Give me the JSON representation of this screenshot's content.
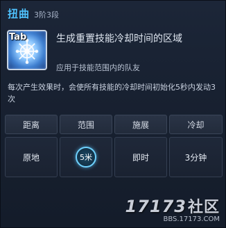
{
  "skill": {
    "name": "扭曲",
    "level": "3阶3段",
    "hotkey": "Tab",
    "icon": "swirl-snowflake-icon",
    "title": "生成重置技能冷却时间的区域",
    "subtitle": "应用于技能范围内的队友",
    "effect": "每次产生效果时，会使所有技能的冷却时间初始化5秒内发动3次"
  },
  "stats": {
    "headers": [
      "距离",
      "范围",
      "施展",
      "冷却"
    ],
    "values": [
      "原地",
      "5米",
      "即时",
      "3分钟"
    ]
  },
  "watermark": {
    "logo": "17173",
    "logo_cn": "社区",
    "url": "BBS.17173.COM"
  },
  "colors": {
    "skill_name": "#4fc3ff",
    "panel_bg": "#182131",
    "range_ring": "#6fd2ff"
  }
}
